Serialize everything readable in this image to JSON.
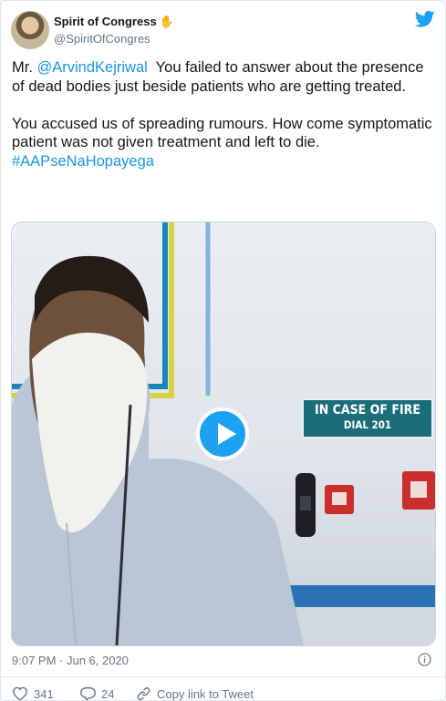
{
  "author": {
    "name": "Spirit of Congress",
    "emoji": "✋",
    "handle": "@SpiritOfCongres"
  },
  "tweet": {
    "line1_prefix": "Mr. ",
    "mention": "@ArvindKejriwal",
    "line1_rest": "  You failed to answer about the presence of dead bodies just beside patients who are getting treated.",
    "paragraph2": "You accused us of spreading rumours. How come symptomatic patient was not given treatment and left to die.",
    "hashtag": "#AAPseNaHopayega"
  },
  "media": {
    "sign_line1": "IN CASE OF FIRE",
    "sign_line2": "DIAL 201"
  },
  "meta": {
    "timestamp": "9:07 PM · Jun 6, 2020"
  },
  "actions": {
    "likes": "341",
    "replies": "24",
    "copy_link": "Copy link to Tweet"
  },
  "colors": {
    "accent": "#1da1f2",
    "link": "#1b95e0",
    "muted": "#657786",
    "text": "#14171a"
  },
  "icons": {
    "platform": "twitter-bird-icon",
    "info": "info-icon",
    "like": "heart-icon",
    "reply": "reply-bubble-icon",
    "link": "link-icon",
    "play": "play-icon"
  }
}
